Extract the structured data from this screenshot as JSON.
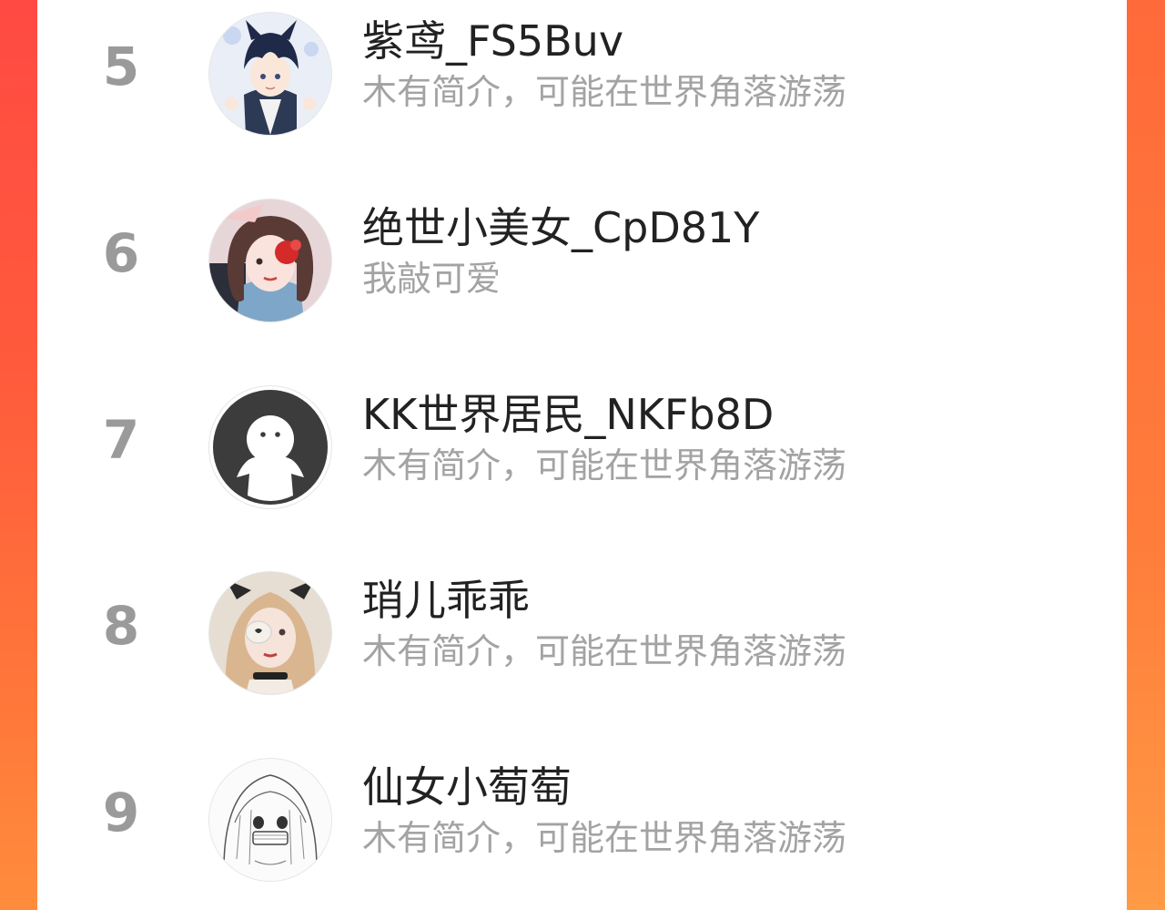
{
  "leaderboard": {
    "items": [
      {
        "rank": "5",
        "name": "紫鸢_FS5Buv",
        "bio": "木有简介，可能在世界角落游荡",
        "avatar_icon": "anime-boy-avatar-icon"
      },
      {
        "rank": "6",
        "name": "绝世小美女_CpD81Y",
        "bio": "我敲可爱",
        "avatar_icon": "anime-girl-red-flower-avatar-icon"
      },
      {
        "rank": "7",
        "name": "KK世界居民_NKFb8D",
        "bio": "木有简介，可能在世界角落游荡",
        "avatar_icon": "default-ghost-avatar-icon"
      },
      {
        "rank": "8",
        "name": "琑儿乖乖",
        "bio": "木有简介，可能在世界角落游荡",
        "avatar_icon": "girl-eyepatch-avatar-icon"
      },
      {
        "rank": "9",
        "name": "仙女小萄萄",
        "bio": "木有简介，可能在世界角落游荡",
        "avatar_icon": "sketch-girl-avatar-icon"
      }
    ]
  },
  "colors": {
    "background_left": "#ff4a43",
    "background_right": "#ff8c3d",
    "rank_text": "#9a9a9a",
    "name_text": "#222222",
    "bio_text": "#a3a3a3"
  }
}
